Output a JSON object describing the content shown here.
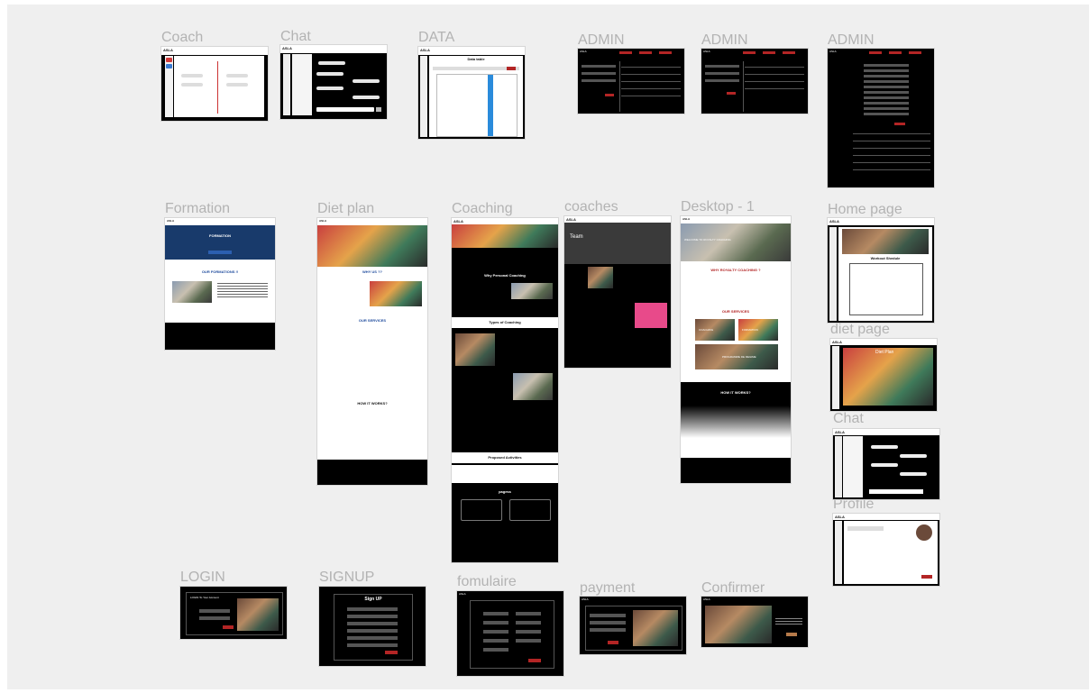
{
  "frames": {
    "coach": "Coach",
    "chat1": "Chat",
    "data": "DATA",
    "admin1": "ADMIN",
    "admin2": "ADMIN",
    "admin3": "ADMIN",
    "formation": "Formation",
    "diet_plan": "Diet plan",
    "coaching": "Coaching",
    "coaches": "coaches",
    "desktop": "Desktop - 1",
    "home": "Home page",
    "diet_page": "diet page",
    "chat2": "Chat",
    "profile": "Profile",
    "login": "LOGIN",
    "signup": "SIGNUP",
    "formulaire": "fomulaire",
    "payment": "payment",
    "confirmer": "Confirmer"
  },
  "content": {
    "logo": "ASLA",
    "data_title": "Data table",
    "formation_title": "FORMATION",
    "our_formations": "OUR FORMATIONS !!",
    "why_us": "WHY US ??",
    "our_services": "OUR SERVICES",
    "how_it_works": "HOW IT WORKS?",
    "why_personal": "Why Personal Coaching",
    "types_coaching": "Types of Coaching",
    "proposed_activities": "Proposed Activities",
    "pagess": "pagess",
    "team": "Team",
    "welcome": "WELCOME TO ROYALTY COACHING",
    "why_royalty": "WHY ROYALTY COACHING ?",
    "diet_plan": "Diet Plan",
    "workout_schedule": "Workout Shedule",
    "sign_up": "Sign UP",
    "login_title": "LOGIN To Your Account",
    "coaching_tile": "COACHING",
    "formation_tile": "FORMATION",
    "programme_tile": "PROGRAMME DE REGIME"
  },
  "colors": {
    "accent": "#b32525",
    "frame_bg": "#000000",
    "canvas": "#efefef",
    "label": "#b3b3b3"
  }
}
